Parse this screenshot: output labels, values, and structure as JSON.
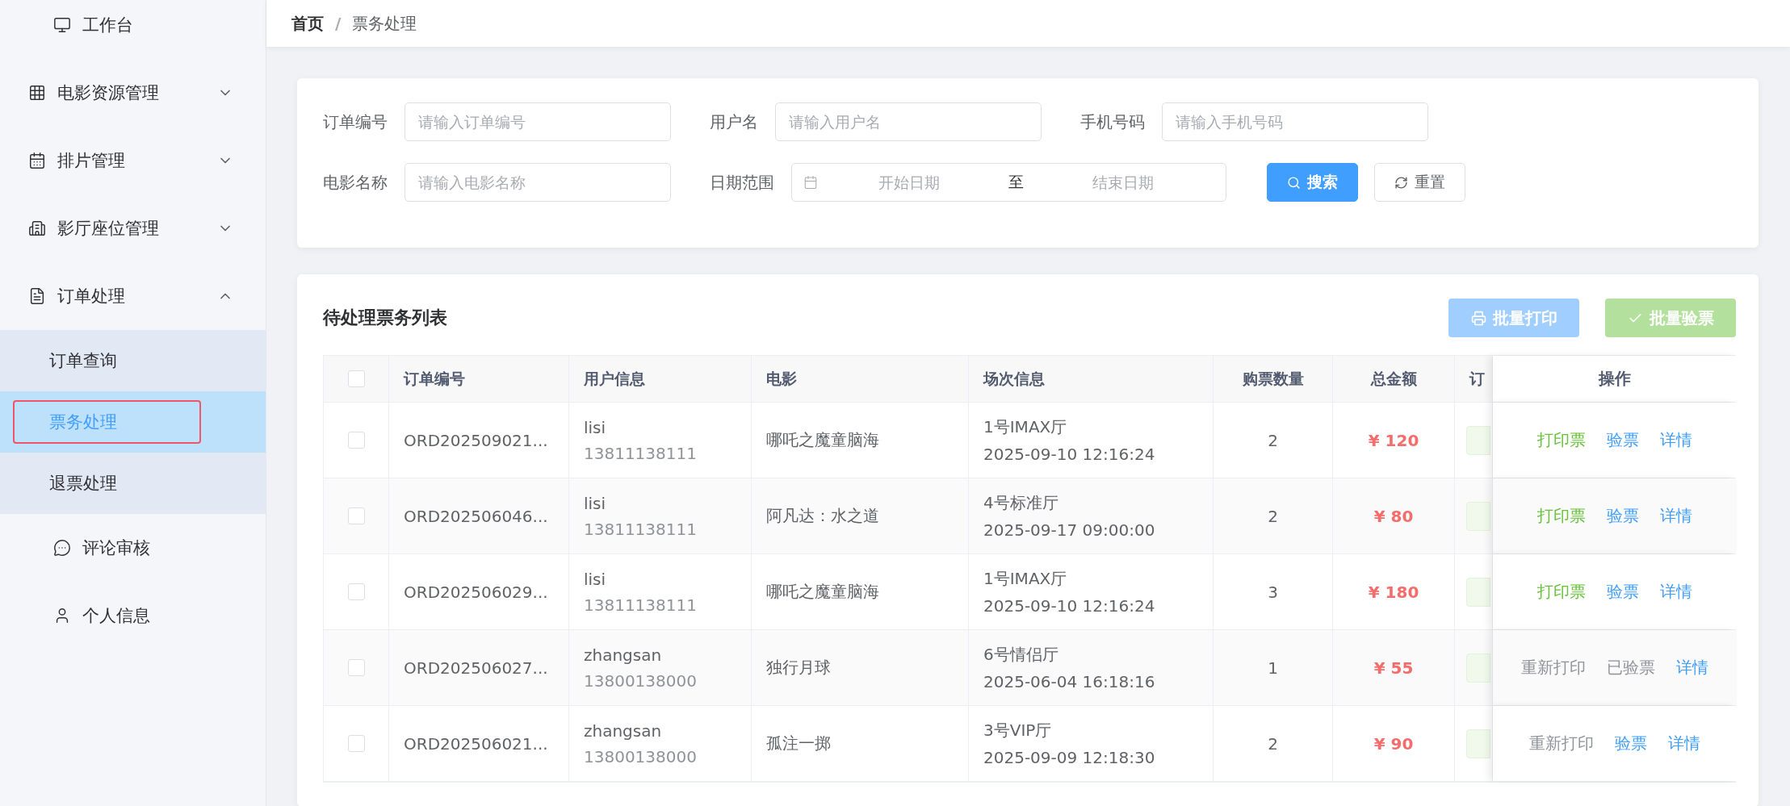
{
  "sidebar": {
    "items": [
      {
        "kind": "link",
        "label": "工作台"
      },
      {
        "kind": "group",
        "label": "电影资源管理",
        "expanded": false
      },
      {
        "kind": "group",
        "label": "排片管理",
        "expanded": false
      },
      {
        "kind": "group",
        "label": "影厅座位管理",
        "expanded": false
      },
      {
        "kind": "group",
        "label": "订单处理",
        "expanded": true,
        "children": [
          {
            "label": "订单查询",
            "selected": false,
            "highlighted": false
          },
          {
            "label": "票务处理",
            "selected": true,
            "highlighted": true
          },
          {
            "label": "退票处理",
            "selected": false,
            "highlighted": false
          }
        ]
      },
      {
        "kind": "link",
        "label": "评论审核"
      },
      {
        "kind": "link",
        "label": "个人信息"
      }
    ]
  },
  "breadcrumb": [
    {
      "label": "首页",
      "current": false
    },
    {
      "label": "票务处理",
      "current": true
    }
  ],
  "breadcrumb_separator": "/",
  "filters": {
    "rows": [
      [
        {
          "kind": "text",
          "label": "订单编号",
          "placeholder": "请输入订单编号"
        },
        {
          "kind": "text",
          "label": "用户名",
          "placeholder": "请输入用户名"
        },
        {
          "kind": "text",
          "label": "手机号码",
          "placeholder": "请输入手机号码"
        }
      ],
      [
        {
          "kind": "text",
          "label": "电影名称",
          "placeholder": "请输入电影名称"
        },
        {
          "kind": "daterange",
          "label": "日期范围",
          "start_placeholder": "开始日期",
          "separator": "至",
          "end_placeholder": "结束日期"
        }
      ]
    ],
    "buttons": [
      {
        "kind": "primary",
        "label": "搜索"
      },
      {
        "kind": "default",
        "label": "重置"
      }
    ]
  },
  "list": {
    "title": "待处理票务列表",
    "buttons": [
      {
        "kind": "print",
        "label": "批量打印",
        "disabled": true
      },
      {
        "kind": "verify",
        "label": "批量验票",
        "disabled": true
      }
    ],
    "columns": [
      "订单编号",
      "用户信息",
      "电影",
      "场次信息",
      "购票数量",
      "总金额",
      "订",
      "操作"
    ],
    "select_all": {
      "checked": false
    },
    "rows": [
      {
        "checked": false,
        "order": "ORD202509021...",
        "user": "lisi",
        "phone": "13811138111",
        "movie": "哪吒之魔童脑海",
        "hall": "1号IMAX厅",
        "time": "2025-09-10 12:16:24",
        "quantity": "2",
        "amount": "¥ 120",
        "actions": [
          {
            "kind": "print",
            "label": "打印票"
          },
          {
            "kind": "verify",
            "label": "验票"
          },
          {
            "kind": "detail",
            "label": "详情"
          }
        ]
      },
      {
        "checked": false,
        "order": "ORD202506046...",
        "user": "lisi",
        "phone": "13811138111",
        "movie": "阿凡达：水之道",
        "hall": "4号标准厅",
        "time": "2025-09-17 09:00:00",
        "quantity": "2",
        "amount": "¥ 80",
        "actions": [
          {
            "kind": "print",
            "label": "打印票"
          },
          {
            "kind": "verify",
            "label": "验票"
          },
          {
            "kind": "detail",
            "label": "详情"
          }
        ]
      },
      {
        "checked": false,
        "order": "ORD202506029...",
        "user": "lisi",
        "phone": "13811138111",
        "movie": "哪吒之魔童脑海",
        "hall": "1号IMAX厅",
        "time": "2025-09-10 12:16:24",
        "quantity": "3",
        "amount": "¥ 180",
        "actions": [
          {
            "kind": "print",
            "label": "打印票"
          },
          {
            "kind": "verify",
            "label": "验票"
          },
          {
            "kind": "detail",
            "label": "详情"
          }
        ]
      },
      {
        "checked": false,
        "order": "ORD202506027...",
        "user": "zhangsan",
        "phone": "13800138000",
        "movie": "独行月球",
        "hall": "6号情侣厅",
        "time": "2025-06-04 16:18:16",
        "quantity": "1",
        "amount": "¥ 55",
        "actions": [
          {
            "kind": "reprint",
            "label": "重新打印"
          },
          {
            "kind": "verified",
            "label": "已验票"
          },
          {
            "kind": "detail",
            "label": "详情"
          }
        ]
      },
      {
        "checked": false,
        "order": "ORD202506021...",
        "user": "zhangsan",
        "phone": "13800138000",
        "movie": "孤注一掷",
        "hall": "3号VIP厅",
        "time": "2025-09-09 12:18:30",
        "quantity": "2",
        "amount": "¥ 90",
        "actions": [
          {
            "kind": "reprint",
            "label": "重新打印"
          },
          {
            "kind": "verify",
            "label": "验票"
          },
          {
            "kind": "detail",
            "label": "详情"
          }
        ]
      }
    ]
  }
}
